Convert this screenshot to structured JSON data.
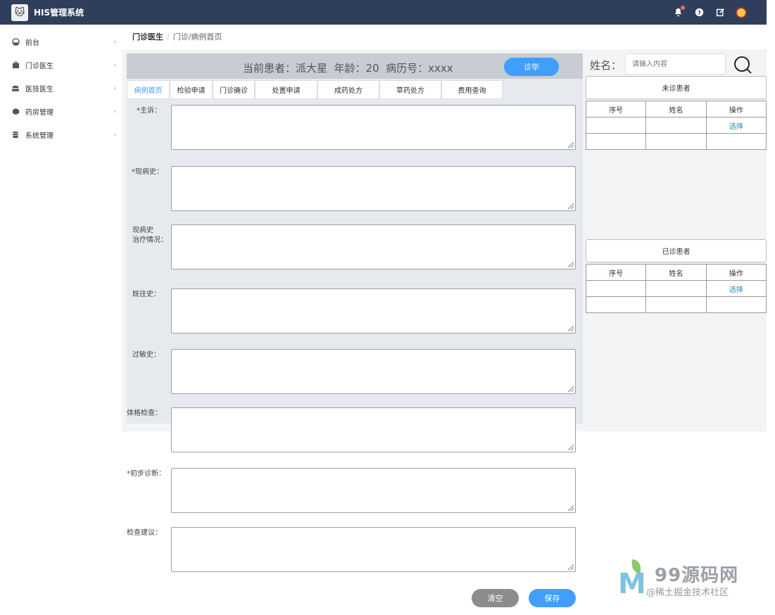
{
  "header": {
    "app_title": "HIS管理系统"
  },
  "sidebar": {
    "items": [
      {
        "label": "前台"
      },
      {
        "label": "门诊医生"
      },
      {
        "label": "医技医生"
      },
      {
        "label": "药房管理"
      },
      {
        "label": "系统管理"
      }
    ]
  },
  "breadcrumb": {
    "current": "门诊医生",
    "sep": "/",
    "path": "门诊/病例首页"
  },
  "patient": {
    "info": "当前患者：派大星  年龄：20  病历号：xxxx",
    "finish_label": "诊毕"
  },
  "tabs": [
    "病例首页",
    "检验申请",
    "门诊确诊",
    "处置申请",
    "成药处方",
    "草药处方",
    "费用查询"
  ],
  "form": {
    "fields": [
      {
        "label": "*主诉："
      },
      {
        "label": "*现病史："
      },
      {
        "label": "现病史\n治疗情况："
      },
      {
        "label": "既往史："
      },
      {
        "label": "过敏史："
      },
      {
        "label": "体格检查："
      },
      {
        "label": "*初步诊断："
      },
      {
        "label": "检查建议："
      }
    ]
  },
  "actions": {
    "clear_label": "清空",
    "save_label": "保存"
  },
  "search": {
    "label": "姓名：",
    "placeholder": "请输入内容"
  },
  "pending": {
    "title": "未诊患者",
    "headers": [
      "序号",
      "姓名",
      "操作"
    ],
    "rows": [
      [
        "",
        "",
        "选择"
      ],
      [
        "",
        "",
        ""
      ]
    ]
  },
  "done": {
    "title": "已诊患者",
    "headers": [
      "序号",
      "姓名",
      "操作"
    ],
    "rows": [
      [
        "",
        "",
        "选择"
      ],
      [
        "",
        "",
        ""
      ]
    ]
  },
  "watermark": {
    "brand": "99源码网",
    "sub": "@稀土掘金技术社区"
  }
}
